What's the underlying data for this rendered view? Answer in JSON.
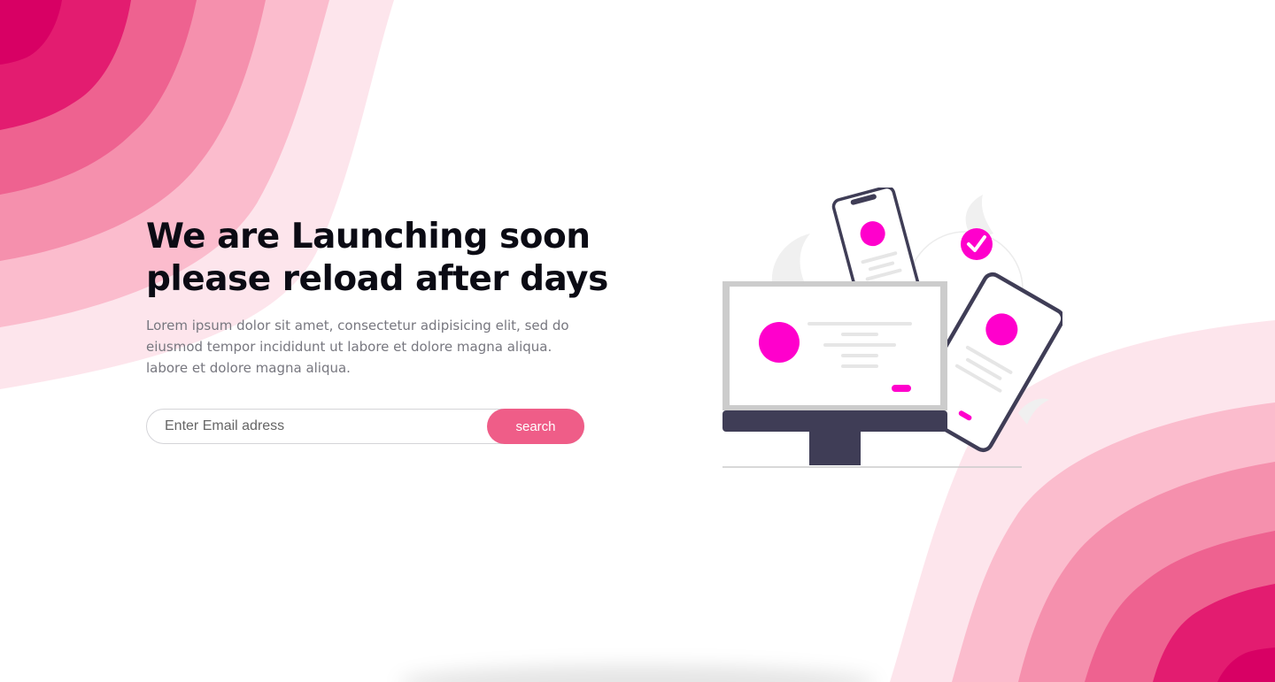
{
  "hero": {
    "title_line1": "We are Launching soon",
    "title_line2": "please reload after days",
    "description_line1": "Lorem ipsum dolor sit amet, consectetur adipisicing elit, sed do",
    "description_line2": "eiusmod tempor incididunt ut labore et dolore magna aliqua.",
    "description_line3": "labore et dolore magna aliqua."
  },
  "form": {
    "email_placeholder": "Enter Email adress",
    "email_value": "",
    "search_label": "search"
  },
  "colors": {
    "accent": "#ef5d88",
    "illustration_accent": "#ff00cc",
    "device_dark": "#3f3d56",
    "wave_1": "#d80064",
    "wave_2": "#e31c70",
    "wave_3": "#ee6290",
    "wave_4": "#f590ad",
    "wave_5": "#fbbccd",
    "wave_6": "#fde5ec"
  }
}
